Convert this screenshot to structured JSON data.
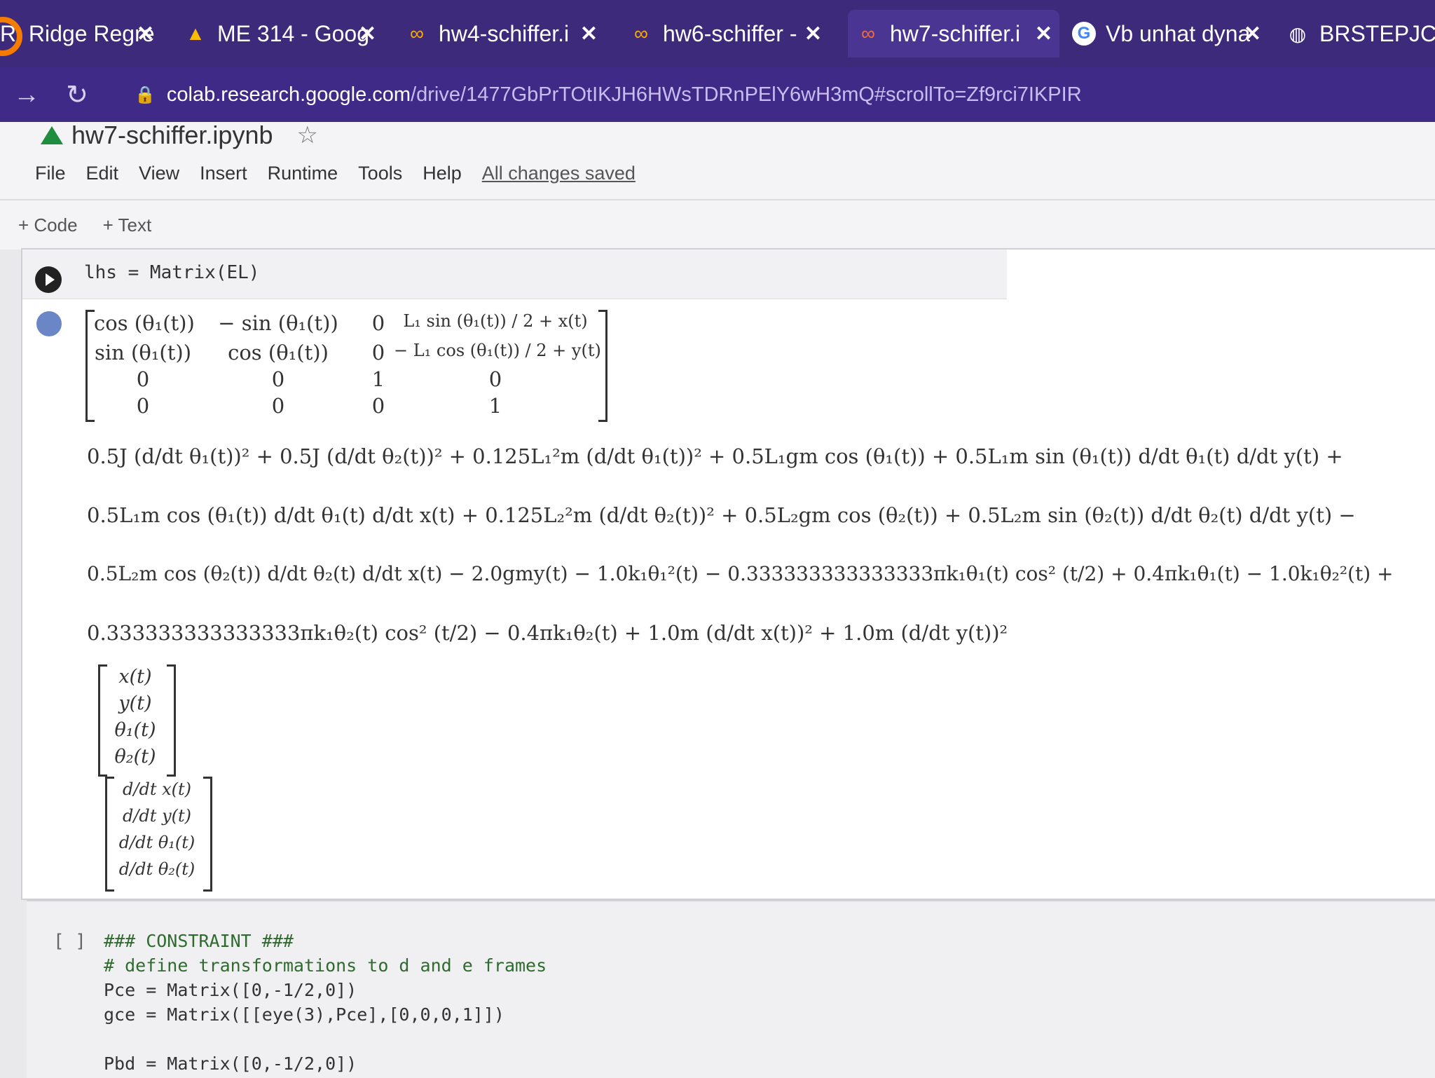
{
  "tabs": [
    {
      "title": "R: Ridge Regre",
      "icon": ""
    },
    {
      "title": "ME 314 - Goog",
      "icon": "drive-icon"
    },
    {
      "title": "hw4-schiffer.i",
      "icon": "colab-icon"
    },
    {
      "title": "hw6-schiffer -",
      "icon": "colab-icon"
    },
    {
      "title": "hw7-schiffer.i",
      "icon": "colab-icon"
    },
    {
      "title": "Vb unhat dyna",
      "icon": "google-icon"
    },
    {
      "title": "BRSTEPJC.pdf",
      "icon": "globe-icon"
    }
  ],
  "address": {
    "host": "colab.research.google.com",
    "path": "/drive/1477GbPrTOtIKJH6HWsTDRnPElY6wH3mQ#scrollTo=Zf9rci7IKPIR"
  },
  "notebook": {
    "title": "hw7-schiffer.ipynb"
  },
  "menu": {
    "items": [
      "File",
      "Edit",
      "View",
      "Insert",
      "Runtime",
      "Tools",
      "Help"
    ],
    "status": "All changes saved"
  },
  "toolbar": {
    "code": "+ Code",
    "text": "+ Text"
  },
  "cell1": {
    "code": "lhs = Matrix(EL)",
    "matrix": [
      [
        "cos (θ₁(t))",
        "− sin (θ₁(t))",
        "0",
        "L₁ sin (θ₁(t)) / 2 + x(t)"
      ],
      [
        "sin (θ₁(t))",
        "cos (θ₁(t))",
        "0",
        "− L₁ cos (θ₁(t)) / 2 + y(t)"
      ],
      [
        "0",
        "0",
        "1",
        "0"
      ],
      [
        "0",
        "0",
        "0",
        "1"
      ]
    ],
    "equation_lines": [
      "0.5J (d/dt θ₁(t))² + 0.5J (d/dt θ₂(t))² + 0.125L₁²m (d/dt θ₁(t))² + 0.5L₁gm cos (θ₁(t)) + 0.5L₁m sin (θ₁(t)) d/dt θ₁(t) d/dt y(t) +",
      "0.5L₁m cos (θ₁(t)) d/dt θ₁(t) d/dt x(t) + 0.125L₂²m (d/dt θ₂(t))² + 0.5L₂gm cos (θ₂(t)) + 0.5L₂m sin (θ₂(t)) d/dt θ₂(t) d/dt y(t) −",
      "0.5L₂m cos (θ₂(t)) d/dt θ₂(t) d/dt x(t) − 2.0gmy(t) − 1.0k₁θ₁²(t) − 0.333333333333333πk₁θ₁(t) cos² (t/2) + 0.4πk₁θ₁(t) − 1.0k₁θ₂²(t) +",
      "0.333333333333333πk₁θ₂(t) cos² (t/2) − 0.4πk₁θ₂(t) + 1.0m (d/dt x(t))² + 1.0m (d/dt y(t))²"
    ],
    "vector_q": [
      "x(t)",
      "y(t)",
      "θ₁(t)",
      "θ₂(t)"
    ],
    "vector_qdot": [
      "d/dt x(t)",
      "d/dt y(t)",
      "d/dt θ₁(t)",
      "d/dt θ₂(t)"
    ]
  },
  "cell2": {
    "bracket": "[ ]",
    "lines": [
      "### CONSTRAINT ###",
      "# define transformations to d and e frames",
      "Pce = Matrix([0,-1/2,0])",
      "gce = Matrix([[eye(3),Pce],[0,0,0,1]])",
      "",
      "Pbd = Matrix([0,-1/2,0])"
    ]
  },
  "colors": {
    "tabbar": "#3d2a7a",
    "address": "#402a88",
    "accent": "#f57c00",
    "drive": "#1e8e3e"
  }
}
